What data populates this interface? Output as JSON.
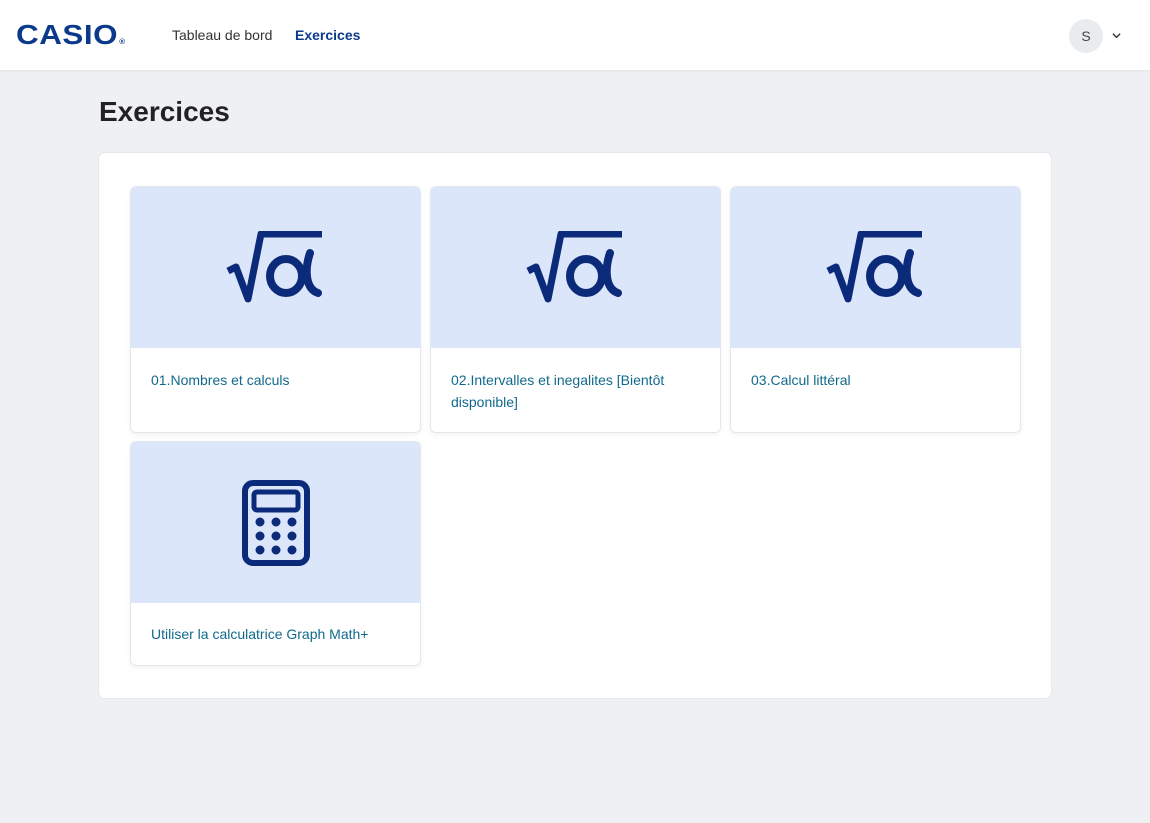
{
  "brand": {
    "logo_text": "CASIO",
    "logo_mark": "®",
    "color": "#0b3a8c"
  },
  "nav": {
    "links": [
      {
        "label": "Tableau de bord",
        "active": false
      },
      {
        "label": "Exercices",
        "active": true
      }
    ]
  },
  "user": {
    "avatar_initial": "S",
    "menu_icon": "chevron-down-icon"
  },
  "page": {
    "title": "Exercices"
  },
  "cards": [
    {
      "title": "01.Nombres et calculs",
      "icon": "sqrt-alpha-icon"
    },
    {
      "title": "02.Intervalles et inegalites [Bientôt disponible]",
      "icon": "sqrt-alpha-icon"
    },
    {
      "title": "03.Calcul littéral",
      "icon": "sqrt-alpha-icon"
    },
    {
      "title": "Utiliser la calculatrice Graph Math+",
      "icon": "calculator-icon"
    }
  ],
  "colors": {
    "accent": "#0b3a8c",
    "card_header_bg": "#dce6fa",
    "link": "#116a8c",
    "page_bg": "#eef0f4"
  }
}
